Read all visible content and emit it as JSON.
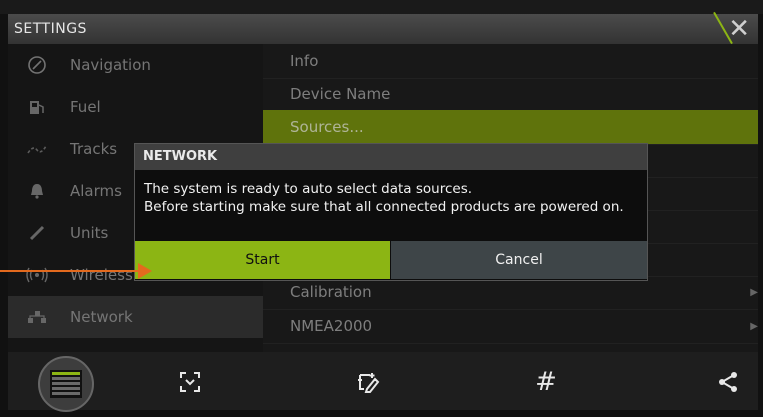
{
  "title": "SETTINGS",
  "sidebar": {
    "items": [
      {
        "label": "Navigation",
        "icon": "compass-icon"
      },
      {
        "label": "Fuel",
        "icon": "fuel-pump-icon"
      },
      {
        "label": "Tracks",
        "icon": "tracks-icon"
      },
      {
        "label": "Alarms",
        "icon": "bell-icon"
      },
      {
        "label": "Units",
        "icon": "ruler-icon"
      },
      {
        "label": "Wireless",
        "icon": "wireless-icon"
      },
      {
        "label": "Network",
        "icon": "network-icon",
        "active": true
      }
    ]
  },
  "list": {
    "rows": [
      {
        "label": "Info"
      },
      {
        "label": "Device Name"
      },
      {
        "label": "Sources...",
        "selected": true
      },
      {
        "label": ""
      },
      {
        "label": ""
      },
      {
        "label": ""
      },
      {
        "label": ""
      },
      {
        "label": "Calibration",
        "chevron": true
      },
      {
        "label": "NMEA2000",
        "chevron": true
      }
    ]
  },
  "dialog": {
    "title": "NETWORK",
    "line1": "The system is ready to auto select data sources.",
    "line2": "Before starting make sure that all connected products are powered on.",
    "start_label": "Start",
    "cancel_label": "Cancel"
  },
  "toolbar": {
    "buttons": [
      "home-thumbnail-icon",
      "vessel-focus-icon",
      "edit-pages-icon",
      "grid-icon",
      "share-icon"
    ],
    "grid_symbol": "#"
  },
  "colors": {
    "accent": "#8cb514",
    "pointer": "#e36a1e",
    "selected_row": "#7f9a10"
  }
}
